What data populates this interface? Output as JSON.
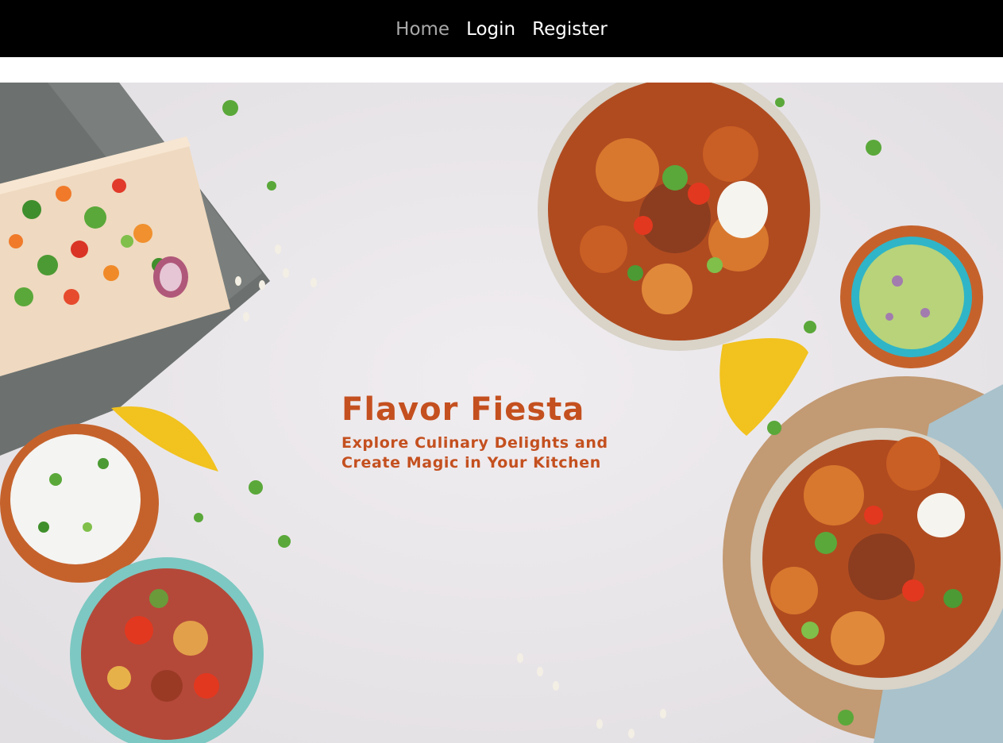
{
  "nav": {
    "items": [
      {
        "label": "Home",
        "active": true
      },
      {
        "label": "Login",
        "active": false
      },
      {
        "label": "Register",
        "active": false
      }
    ]
  },
  "hero": {
    "title": "Flavor Fiesta",
    "subtitle_line1": "Explore Culinary Delights and",
    "subtitle_line2": "Create Magic in Your Kitchen",
    "text_color": "#c4501f",
    "background_color": "#ece9ec"
  },
  "colors": {
    "nav_bg": "#000000",
    "nav_text": "#ffffff",
    "nav_active_text": "#a9a9a9"
  }
}
